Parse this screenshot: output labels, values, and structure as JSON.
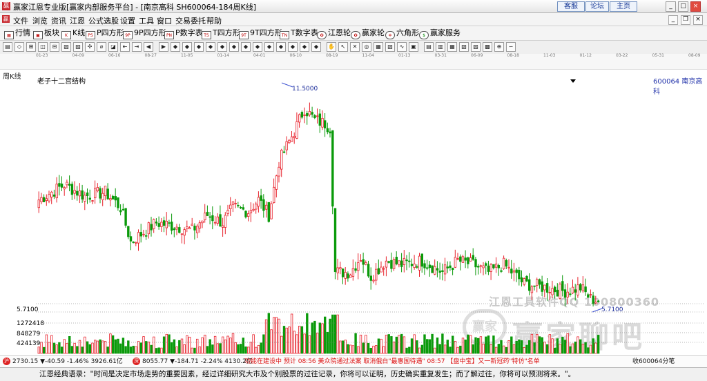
{
  "window": {
    "title": "赢家江恩专业版[赢家内部服务平台] - [南京高科  SH600064-184周K线]",
    "links": [
      "客服",
      "论坛",
      "主页"
    ]
  },
  "menu": [
    "文件",
    "浏览",
    "资讯",
    "江恩",
    "公式选股",
    "设置",
    "工具",
    "窗口",
    "交易委托",
    "帮助"
  ],
  "nav": [
    "行情",
    "板块",
    "K线",
    "P四方形",
    "9P四方形",
    "P数字表",
    "T四方形",
    "9T四方形",
    "T数字表",
    "江恩轮",
    "赢家轮",
    "六角形",
    "赢家服务"
  ],
  "chart_header": {
    "period": "周K线",
    "indicator": "老子十二宫结构",
    "code_name": "600064  南京高科"
  },
  "chart_data": {
    "type": "candlestick",
    "date_ticks": [
      "01-23",
      "04-09",
      "06-16",
      "08-27",
      "11-05",
      "01-14",
      "04-01",
      "06-10",
      "08-19",
      "11-04",
      "01-13",
      "03-31",
      "06-09",
      "08-18",
      "11-03",
      "01-12",
      "03-22",
      "05-31",
      "08-09"
    ],
    "price_range": [
      5.7,
      11.5
    ],
    "high_label": "11.5000",
    "low_label": "5.7100",
    "volume_labels": [
      "1272418",
      "848279",
      "424139"
    ],
    "y_label": "5.7100",
    "colors": {
      "up": "#e8202a",
      "down": "#0a9a0a",
      "dashed": "#6a6a6a",
      "marker": "#3b50d0"
    }
  },
  "ticker": {
    "sh_index": "2730.15 ▼-40.59 -1.46% 3926.61亿",
    "sz_index": "8055.77 ▼-184.71 -2.24% 4130.2亿",
    "news": "功能在建设中 预计 08:56 美众院通过法案 取消俄白\"最惠国待遇\" 08:57 【盘中宝】又一新冠药\"特仿\"名单",
    "right": "收600064分笔",
    "badges": [
      "沪",
      "深"
    ]
  },
  "quote": "江恩经典语录：\"时间是决定市场走势的重要因素，经过详细研究大市及个别股票的过往记录，你将可以证明，历史确实重复发生；而了解过往，你将可以预测将来。\"。",
  "watermark": {
    "line1": "江恩工具软件QQ 100800360",
    "line2": "赢家聊吧",
    "logo": "赢家"
  }
}
